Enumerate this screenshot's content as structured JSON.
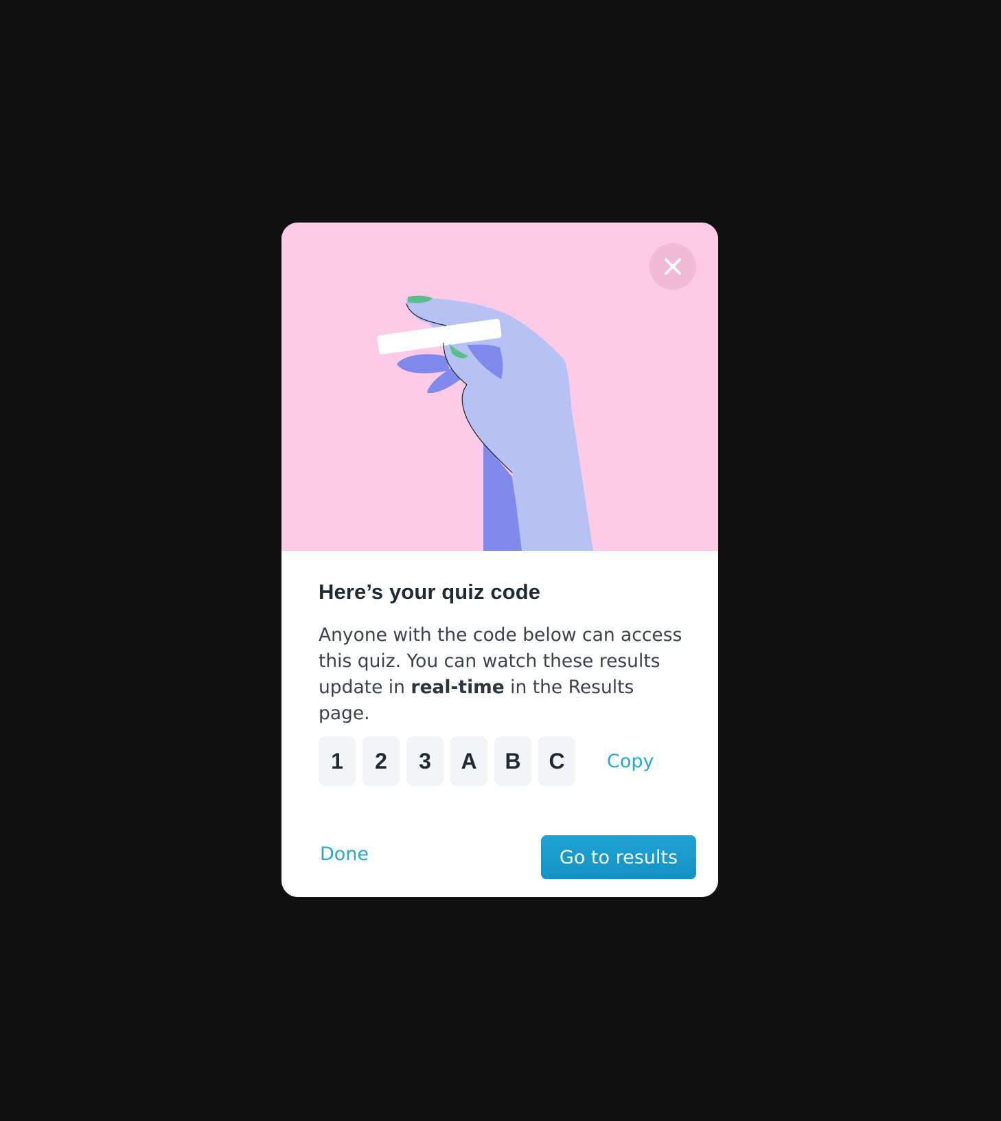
{
  "dialog": {
    "title": "Here’s your quiz code",
    "description": {
      "before": "Anyone with the code below can access this quiz. You can watch these results update in ",
      "emphasis": "real-time",
      "after": " in the Results page."
    },
    "code": [
      "1",
      "2",
      "3",
      "A",
      "B",
      "C"
    ],
    "copy_label": "Copy",
    "done_label": "Done",
    "primary_label": "Go to results"
  },
  "icons": {
    "close": "close-icon",
    "illustration": "hand-holding-strip-illustration"
  },
  "colors": {
    "backdrop": "#111111",
    "hero_background": "#fdcbe6",
    "accent": "#26a8cf",
    "primary_button": "#1a9ccf",
    "text": "#202a33"
  }
}
